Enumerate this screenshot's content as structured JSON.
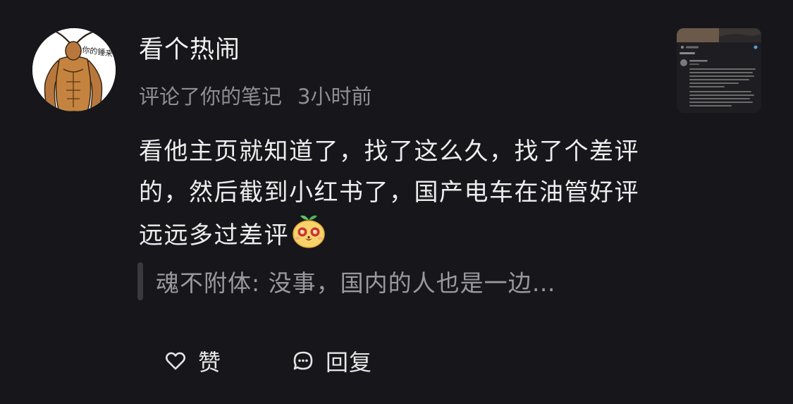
{
  "comment": {
    "username": "看个热闹",
    "action_text": "评论了你的笔记",
    "time": "3小时前",
    "body": "看他主页就知道了，找了这么久，找了个差评的，然后截到小红书了，国产电车在油管好评远远多过差评",
    "quoted": "魂不附体: 没事，国内的人也是一边…",
    "avatar_caption": "你的锤来了"
  },
  "actions": {
    "like_label": "赞",
    "reply_label": "回复"
  },
  "icons": {
    "like": "heart-outline-icon",
    "reply": "chat-bubble-icon",
    "emoji": "grinning-face-emoji-icon"
  },
  "colors": {
    "background": "#17161b",
    "primary_text": "#ededed",
    "secondary_text": "#8f8e93"
  }
}
